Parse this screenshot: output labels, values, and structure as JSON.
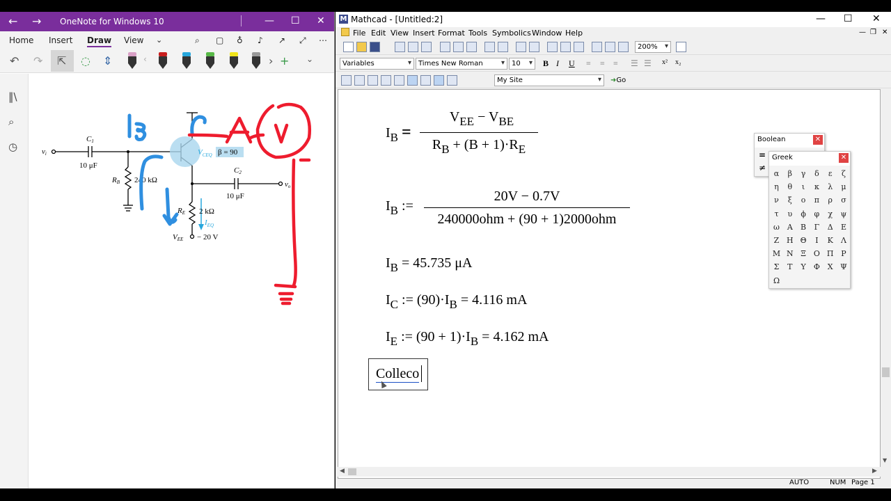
{
  "onenote": {
    "title": "OneNote for Windows 10",
    "menu": [
      "Home",
      "Insert",
      "Draw",
      "View"
    ],
    "pen_colors": [
      "#d9a0c6",
      "#c81e1e",
      "#27a7dd",
      "#58b947",
      "#f0e41a",
      "#333333"
    ],
    "circuit": {
      "vi": "v",
      "vi_sub": "i",
      "c1": "C",
      "c1_sub": "1",
      "c1_val": "10 μF",
      "rb": "R",
      "rb_sub": "B",
      "rb_val": "240 kΩ",
      "vce": "V",
      "vce_sub": "CEQ",
      "beta": "β = 90",
      "c2": "C",
      "c2_sub": "2",
      "c2_val": "10 μF",
      "vo": "v",
      "vo_sub": "o",
      "re": "R",
      "re_sub": "E",
      "re_val": "2 kΩ",
      "ieq": "I",
      "ieq_sub": "EQ",
      "vee": "V",
      "vee_sub": "EE",
      "vee_val": "− 20 V"
    },
    "ink_labels": {
      "ib": "IB",
      "a": "A",
      "v": "v"
    }
  },
  "mathcad": {
    "title": "Mathcad - [Untitled:2]",
    "menu": [
      "File",
      "Edit",
      "View",
      "Insert",
      "Format",
      "Tools",
      "Symbolics",
      "Window",
      "Help"
    ],
    "zoom": "200%",
    "style": "Variables",
    "font": "Times New Roman",
    "size": "10",
    "site": "My Site",
    "go": "Go",
    "status": {
      "auto": "AUTO",
      "num": "NUM",
      "page": "Page 1"
    },
    "eq1": {
      "lhs": "I",
      "lhs_sub": "B",
      "op": "=",
      "num": "V",
      "num_sub1": "EE",
      "num_mid": " − V",
      "num_sub2": "BE",
      "den": "R",
      "den_sub1": "B",
      "den_mid": " + (B + 1)·R",
      "den_sub2": "E"
    },
    "eq2": {
      "lhs": "I",
      "lhs_sub": "B",
      "op": ":=",
      "num": "20V − 0.7V",
      "den": "240000ohm + (90 + 1)2000ohm"
    },
    "eq3": {
      "lhs": "I",
      "lhs_sub": "B",
      "rest": " = 45.735 μA"
    },
    "eq4": {
      "lhs": "I",
      "lhs_sub": "C",
      "mid": " := (90)·I",
      "mid_sub": "B",
      "rest": " = 4.116 mA"
    },
    "eq5": {
      "lhs": "I",
      "lhs_sub": "E",
      "mid": " := (90 + 1)·I",
      "mid_sub": "B",
      "rest": " = 4.162 mA"
    },
    "text_region": "Colleco",
    "boolean_palette": {
      "title": "Boolean",
      "items": [
        "=",
        "≠"
      ]
    },
    "greek_palette": {
      "title": "Greek",
      "letters": [
        "α",
        "β",
        "γ",
        "δ",
        "ε",
        "ζ",
        "η",
        "θ",
        "ι",
        "κ",
        "λ",
        "μ",
        "ν",
        "ξ",
        "ο",
        "π",
        "ρ",
        "σ",
        "τ",
        "υ",
        "ϕ",
        "φ",
        "χ",
        "ψ",
        "ω",
        "Α",
        "Β",
        "Γ",
        "Δ",
        "Ε",
        "Ζ",
        "Η",
        "Θ",
        "Ι",
        "Κ",
        "Λ",
        "Μ",
        "Ν",
        "Ξ",
        "Ο",
        "Π",
        "Ρ",
        "Σ",
        "Τ",
        "Υ",
        "Φ",
        "Χ",
        "Ψ",
        "Ω"
      ]
    }
  }
}
